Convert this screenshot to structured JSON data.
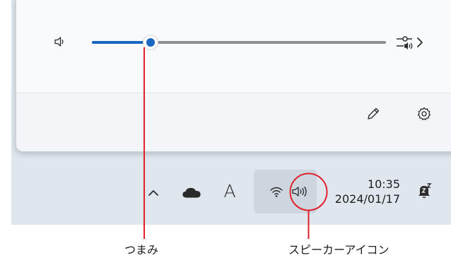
{
  "volume": {
    "level_percent": 20
  },
  "taskbar": {
    "ime_indicator": "A",
    "time": "10:35",
    "date": "2024/01/17"
  },
  "callouts": {
    "thumb_label": "つまみ",
    "speaker_label": "スピーカーアイコン"
  },
  "icons": {
    "mute_button": "speaker-icon",
    "output_select": "speaker-settings-icon",
    "edit": "pencil-icon",
    "settings": "gear-icon",
    "overflow": "chevron-up-icon",
    "onedrive": "cloud-icon",
    "network": "wifi-icon",
    "volume": "speaker-icon",
    "notifications": "bell-zz-icon"
  },
  "colors": {
    "accent": "#1a67c2",
    "callout": "#e0202a"
  }
}
